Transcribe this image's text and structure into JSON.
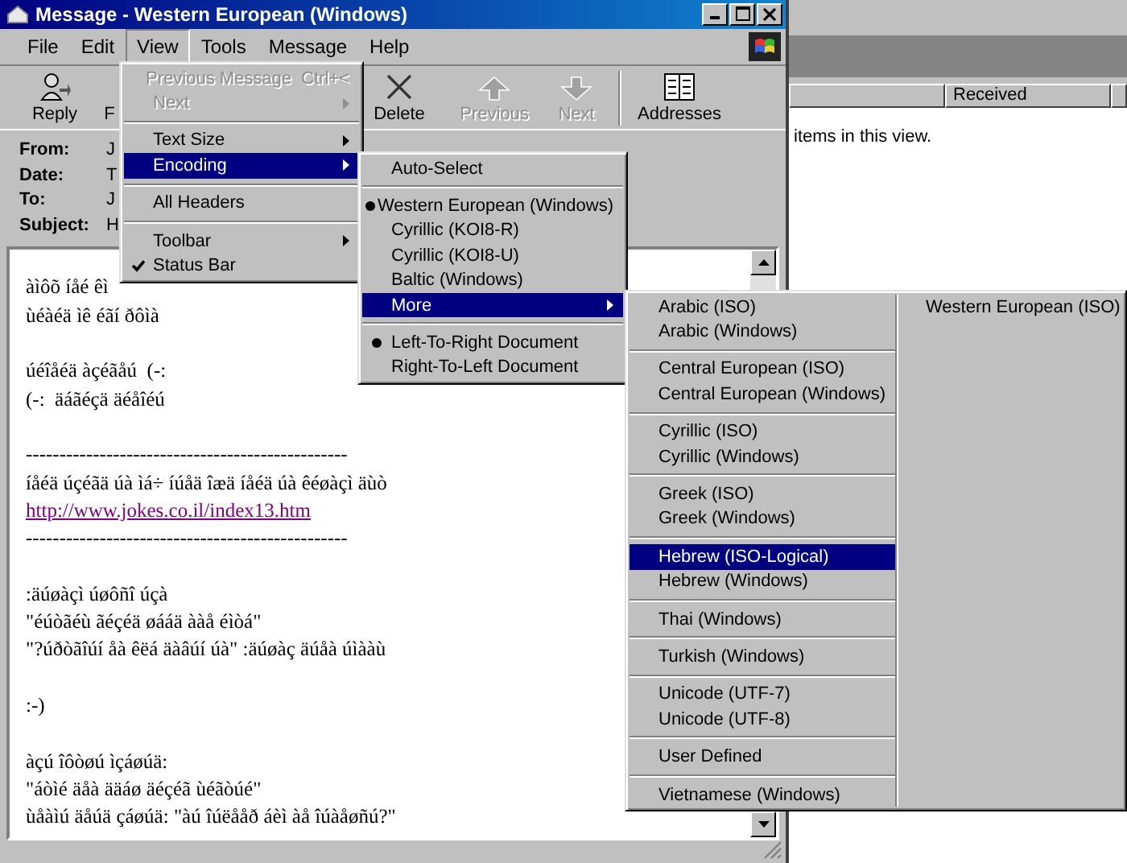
{
  "background_window": {
    "columns": [
      {},
      {
        "label": "Received"
      },
      {}
    ],
    "message": "items in this view."
  },
  "window": {
    "title": "Message - Western European (Windows)",
    "menu": [
      {
        "label": "File",
        "selected": false
      },
      {
        "label": "Edit",
        "selected": false
      },
      {
        "label": "View",
        "selected": true
      },
      {
        "label": "Tools",
        "selected": false
      },
      {
        "label": "Message",
        "selected": false
      },
      {
        "label": "Help",
        "selected": false
      }
    ],
    "toolbar": [
      {
        "kind": "reply",
        "label": "Reply",
        "disabled": false
      },
      {
        "kind": "forward",
        "label": "F",
        "disabled": false
      },
      {
        "kind": "delete",
        "label": "Delete",
        "disabled": false
      },
      {
        "kind": "previous",
        "label": "Previous",
        "disabled": true
      },
      {
        "kind": "next",
        "label": "Next",
        "disabled": true
      },
      {
        "kind": "addresses",
        "label": "Addresses",
        "disabled": false
      }
    ],
    "headers": [
      {
        "label": "From:",
        "value": "J"
      },
      {
        "label": "Date:",
        "value": "T"
      },
      {
        "label": "To:",
        "value": "J"
      },
      {
        "label": "Subject:",
        "value": "H"
      }
    ],
    "body": [
      {
        "kind": "text",
        "text": "àìôõ íåé êì"
      },
      {
        "kind": "text",
        "text": "ùéàéä ìê éãí ðôìà"
      },
      {
        "kind": "blank"
      },
      {
        "kind": "text",
        "text": "úéîåéä àçéãåú  (-:"
      },
      {
        "kind": "text",
        "text": "(-:  äáãéçä äéåîéú"
      },
      {
        "kind": "blank"
      },
      {
        "kind": "text",
        "text": "------------------------------------------------"
      },
      {
        "kind": "text",
        "text": "íåéä úçéãä úà ìá÷ íúåä îæä íåéä úà êéøàçì äùò"
      },
      {
        "kind": "link",
        "text": "http://www.jokes.co.il/index13.htm"
      },
      {
        "kind": "text",
        "text": "------------------------------------------------"
      },
      {
        "kind": "blank"
      },
      {
        "kind": "text",
        "text": ":äúøàçì úøôñî úçà"
      },
      {
        "kind": "text",
        "text": "\"éúòãéù ãéçéä øááä ààå éìòá\""
      },
      {
        "kind": "text",
        "text": "\"?úðòãîúí åà êëá äàâúí úà\" :äúøàç äúåà úìààù"
      },
      {
        "kind": "blank"
      },
      {
        "kind": "text",
        "text": ":-)"
      },
      {
        "kind": "blank"
      },
      {
        "kind": "text",
        "text": "àçú îôòøú ìçáøúä:"
      },
      {
        "kind": "text",
        "text": "\"áòìé äåà ääáø äéçéã ùéãòúé\""
      },
      {
        "kind": "text",
        "text": "ùåàìú äåúä çáøúä: \"àú îúëååð áèì àå îúàåøñú?\""
      }
    ]
  },
  "view_menu": {
    "items": [
      {
        "kind": "item",
        "label": "Previous Message",
        "shortcut": "Ctrl+<",
        "disabled": true,
        "submenu": false,
        "checked": false,
        "selected": false
      },
      {
        "kind": "item",
        "label": "Next",
        "disabled": true,
        "submenu": true,
        "checked": false,
        "selected": false
      },
      {
        "kind": "separator"
      },
      {
        "kind": "item",
        "label": "Text Size",
        "disabled": false,
        "submenu": true,
        "checked": false,
        "selected": false
      },
      {
        "kind": "item",
        "label": "Encoding",
        "disabled": false,
        "submenu": true,
        "checked": false,
        "selected": true
      },
      {
        "kind": "separator"
      },
      {
        "kind": "item",
        "label": "All Headers",
        "disabled": false,
        "submenu": false,
        "checked": false,
        "selected": false
      },
      {
        "kind": "separator"
      },
      {
        "kind": "item",
        "label": "Toolbar",
        "disabled": false,
        "submenu": true,
        "checked": false,
        "selected": false
      },
      {
        "kind": "item",
        "label": "Status Bar",
        "disabled": false,
        "submenu": false,
        "checked": true,
        "selected": false
      }
    ]
  },
  "encoding_menu": {
    "items": [
      {
        "kind": "item",
        "label": "Auto-Select",
        "disabled": false,
        "submenu": false,
        "checked": false,
        "selected": false
      },
      {
        "kind": "separator"
      },
      {
        "kind": "item",
        "label": "Western European (Windows)",
        "disabled": false,
        "submenu": false,
        "checked": true,
        "selected": false
      },
      {
        "kind": "item",
        "label": "Cyrillic (KOI8-R)",
        "disabled": false,
        "submenu": false,
        "checked": false,
        "selected": false
      },
      {
        "kind": "item",
        "label": "Cyrillic (KOI8-U)",
        "disabled": false,
        "submenu": false,
        "checked": false,
        "selected": false
      },
      {
        "kind": "item",
        "label": "Baltic (Windows)",
        "disabled": false,
        "submenu": false,
        "checked": false,
        "selected": false
      },
      {
        "kind": "item",
        "label": "More",
        "disabled": false,
        "submenu": true,
        "checked": false,
        "selected": true
      },
      {
        "kind": "separator"
      },
      {
        "kind": "item",
        "label": "Left-To-Right Document",
        "disabled": false,
        "submenu": false,
        "checked": true,
        "selected": false
      },
      {
        "kind": "item",
        "label": "Right-To-Left Document",
        "disabled": false,
        "submenu": false,
        "checked": false,
        "selected": false
      }
    ]
  },
  "more_menu": {
    "columns": [
      [
        {
          "kind": "item",
          "label": "Arabic (ISO)",
          "disabled": false,
          "submenu": false,
          "checked": false,
          "selected": false
        },
        {
          "kind": "item",
          "label": "Arabic (Windows)",
          "disabled": false,
          "submenu": false,
          "checked": false,
          "selected": false
        },
        {
          "kind": "separator"
        },
        {
          "kind": "item",
          "label": "Central European (ISO)",
          "disabled": false,
          "submenu": false,
          "checked": false,
          "selected": false
        },
        {
          "kind": "item",
          "label": "Central European (Windows)",
          "disabled": false,
          "submenu": false,
          "checked": false,
          "selected": false
        },
        {
          "kind": "separator"
        },
        {
          "kind": "item",
          "label": "Cyrillic (ISO)",
          "disabled": false,
          "submenu": false,
          "checked": false,
          "selected": false
        },
        {
          "kind": "item",
          "label": "Cyrillic (Windows)",
          "disabled": false,
          "submenu": false,
          "checked": false,
          "selected": false
        },
        {
          "kind": "separator"
        },
        {
          "kind": "item",
          "label": "Greek (ISO)",
          "disabled": false,
          "submenu": false,
          "checked": false,
          "selected": false
        },
        {
          "kind": "item",
          "label": "Greek (Windows)",
          "disabled": false,
          "submenu": false,
          "checked": false,
          "selected": false
        },
        {
          "kind": "separator"
        },
        {
          "kind": "item",
          "label": "Hebrew (ISO-Logical)",
          "disabled": false,
          "submenu": false,
          "checked": false,
          "selected": true
        },
        {
          "kind": "item",
          "label": "Hebrew (Windows)",
          "disabled": false,
          "submenu": false,
          "checked": false,
          "selected": false
        },
        {
          "kind": "separator"
        },
        {
          "kind": "item",
          "label": "Thai (Windows)",
          "disabled": false,
          "submenu": false,
          "checked": false,
          "selected": false
        },
        {
          "kind": "separator"
        },
        {
          "kind": "item",
          "label": "Turkish (Windows)",
          "disabled": false,
          "submenu": false,
          "checked": false,
          "selected": false
        },
        {
          "kind": "separator"
        },
        {
          "kind": "item",
          "label": "Unicode (UTF-7)",
          "disabled": false,
          "submenu": false,
          "checked": false,
          "selected": false
        },
        {
          "kind": "item",
          "label": "Unicode (UTF-8)",
          "disabled": false,
          "submenu": false,
          "checked": false,
          "selected": false
        },
        {
          "kind": "separator"
        },
        {
          "kind": "item",
          "label": "User Defined",
          "disabled": false,
          "submenu": false,
          "checked": false,
          "selected": false
        },
        {
          "kind": "separator"
        },
        {
          "kind": "item",
          "label": "Vietnamese (Windows)",
          "disabled": false,
          "submenu": false,
          "checked": false,
          "selected": false
        }
      ],
      [
        {
          "kind": "item",
          "label": "Western European (ISO)",
          "disabled": false,
          "submenu": false,
          "checked": false,
          "selected": false
        }
      ]
    ]
  }
}
